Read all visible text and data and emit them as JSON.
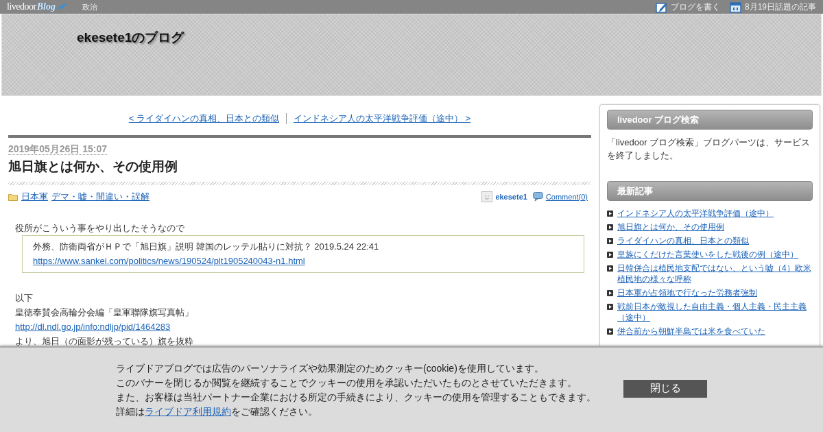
{
  "top_bar": {
    "logo": {
      "name": "livedoor",
      "accent": "Blog"
    },
    "category": "政治",
    "links": [
      {
        "kind": "write",
        "label": "ブログを書く"
      },
      {
        "kind": "calendar",
        "label": "8月19日話題の記事"
      }
    ]
  },
  "blog_title": "ekesete1のブログ",
  "article_nav": {
    "prev": "< ライダイハンの真相、日本との類似",
    "next": "インドネシア人の太平洋戦争評価（途中） >"
  },
  "article": {
    "date": "2019年05月26日 15:07",
    "title": "旭日旗とは何か、その使用例",
    "categories": [
      "日本軍",
      "デマ・嘘・間違い・誤解"
    ],
    "author": "ekesete1",
    "comments": "Comment(0)",
    "body": [
      {
        "kind": "text",
        "text": "役所がこういう事をやり出したそうなので"
      },
      {
        "kind": "quote",
        "text": "外務、防衛両省がＨＰで「旭日旗」説明 韓国のレッテル貼りに対抗？ 2019.5.24 22:41",
        "link": "https://www.sankei.com/politics/news/190524/plt1905240043-n1.html"
      },
      {
        "kind": "spacer"
      },
      {
        "kind": "text",
        "text": "以下"
      },
      {
        "kind": "text",
        "text": "皇徳奉賛会高輪分会編「皇軍聯隊旗写真帖」"
      },
      {
        "kind": "link",
        "text": "http://dl.ndl.go.jp/info:ndljp/pid/1464283"
      },
      {
        "kind": "text",
        "text": "より、旭日（の面影が残っている）旗を抜粋"
      }
    ]
  },
  "sidebar": [
    {
      "kind": "text",
      "title": "livedoor ブログ検索",
      "text": "「livedoor ブログ検索」ブログパーツは、サービスを終了しました。"
    },
    {
      "kind": "links",
      "title": "最新記事",
      "items": [
        "インドネシア人の太平洋戦争評価（途中）",
        "旭日旗とは何か、その使用例",
        "ライダイハンの真相、日本との類似",
        "皇族にくだけた言葉使いをした戦後の例（途中）",
        "日韓併合は植民地支配ではない、という嘘（4）欧米植民地の様々な呼称",
        "日本軍が占領地で行なった労務者強制",
        "戦前日本が敵視した自由主義・個人主義・民主主義（途中）",
        "併合前から朝鮮半島では米を食べていた"
      ]
    }
  ],
  "cookie_banner": {
    "lines": [
      "ライブドアブログでは広告のパーソナライズや効果測定のためクッキー(cookie)を使用しています。",
      "このバナーを閉じるか閲覧を継続することでクッキーの使用を承認いただいたものとさせていただきます。",
      "また、お客様は当社パートナー企業における所定の手続きにより、クッキーの使用を管理することもできます。"
    ],
    "detail": {
      "before": "詳細は",
      "link": "ライブドア利用規約",
      "after": "をご確認ください。"
    },
    "button": "閉じる"
  }
}
